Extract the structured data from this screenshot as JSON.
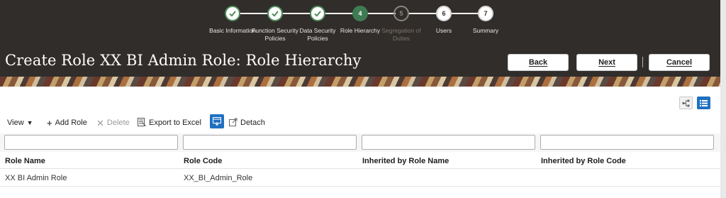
{
  "train": {
    "steps": [
      {
        "number": "1",
        "label": "Basic Information",
        "state": "done"
      },
      {
        "number": "2",
        "label": "Function Security Policies",
        "state": "done"
      },
      {
        "number": "3",
        "label": "Data Security Policies",
        "state": "done"
      },
      {
        "number": "4",
        "label": "Role Hierarchy",
        "state": "current"
      },
      {
        "number": "5",
        "label": "Segregation of Duties",
        "state": "disabled"
      },
      {
        "number": "6",
        "label": "Users",
        "state": "todo"
      },
      {
        "number": "7",
        "label": "Summary",
        "state": "todo"
      }
    ]
  },
  "page": {
    "title": "Create Role XX BI Admin Role: Role Hierarchy"
  },
  "buttons": {
    "back": "Back",
    "next": "Next",
    "cancel": "Cancel"
  },
  "toolbar": {
    "view": "View",
    "add_role": "Add Role",
    "delete": "Delete",
    "export": "Export to Excel",
    "detach": "Detach"
  },
  "table": {
    "columns": [
      "Role Name",
      "Role Code",
      "Inherited by Role Name",
      "Inherited by Role Code"
    ],
    "rows": [
      [
        "XX BI Admin Role",
        "XX_BI_Admin_Role",
        "",
        ""
      ]
    ]
  },
  "colors": {
    "header_bg": "#312d2a",
    "current_step": "#3f7b53",
    "accent_blue": "#1f70c1"
  },
  "icons": {
    "hierarchy_view": "hierarchy-view-icon",
    "list_view": "list-view-icon",
    "add": "plus-icon",
    "delete": "x-icon",
    "export": "export-excel-icon",
    "freeze": "freeze-icon",
    "detach": "detach-icon"
  }
}
